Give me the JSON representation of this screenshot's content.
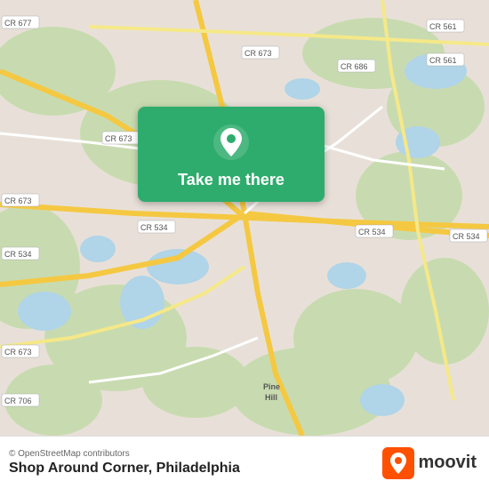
{
  "map": {
    "attribution": "© OpenStreetMap contributors",
    "background_color": "#e8e0d8"
  },
  "location_button": {
    "label": "Take me there",
    "pin_color": "#ffffff",
    "bg_color": "#2eac6d"
  },
  "bottom_bar": {
    "place_name": "Shop Around Corner,",
    "city": "Philadelphia",
    "moovit_text": "moovit",
    "attribution": "© OpenStreetMap contributors"
  },
  "road_labels": [
    {
      "id": "cr677",
      "text": "CR 677"
    },
    {
      "id": "cr673a",
      "text": "CR 673"
    },
    {
      "id": "cr673b",
      "text": "CR 673"
    },
    {
      "id": "cr673c",
      "text": "CR 673"
    },
    {
      "id": "cr686",
      "text": "CR 686"
    },
    {
      "id": "cr561a",
      "text": "CR 561"
    },
    {
      "id": "cr561b",
      "text": "CR 561"
    },
    {
      "id": "cr534a",
      "text": "CR 534"
    },
    {
      "id": "cr534b",
      "text": "CR 534"
    },
    {
      "id": "cr534c",
      "text": "CR 534"
    },
    {
      "id": "cr706",
      "text": "CR 706"
    },
    {
      "id": "pinehill",
      "text": "Pine Hill"
    }
  ]
}
